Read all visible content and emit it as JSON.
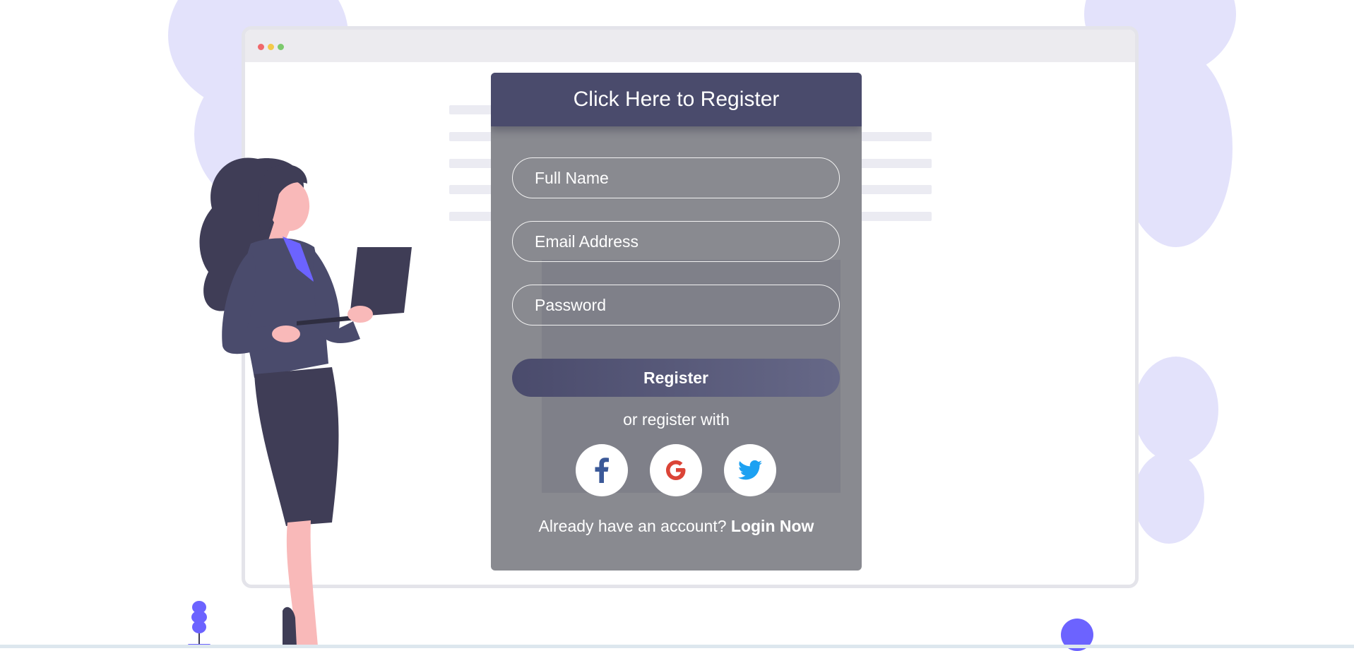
{
  "colors": {
    "panel_bg": "#898a90",
    "header_bg": "#4a4b6c",
    "accent_purple": "#6c63ff",
    "blob": "#e3e2fb",
    "facebook": "#3b5998",
    "google": "#db4437",
    "twitter": "#1da1f2"
  },
  "register": {
    "title": "Click Here to Register",
    "fields": {
      "full_name_placeholder": "Full Name",
      "email_placeholder": "Email Address",
      "password_placeholder": "Password"
    },
    "submit_label": "Register",
    "alt_text": "or register with",
    "social": [
      {
        "name": "facebook",
        "icon": "facebook-icon"
      },
      {
        "name": "google",
        "icon": "google-icon"
      },
      {
        "name": "twitter",
        "icon": "twitter-icon"
      }
    ],
    "login_prompt": "Already have an account?",
    "login_link": "Login Now"
  }
}
